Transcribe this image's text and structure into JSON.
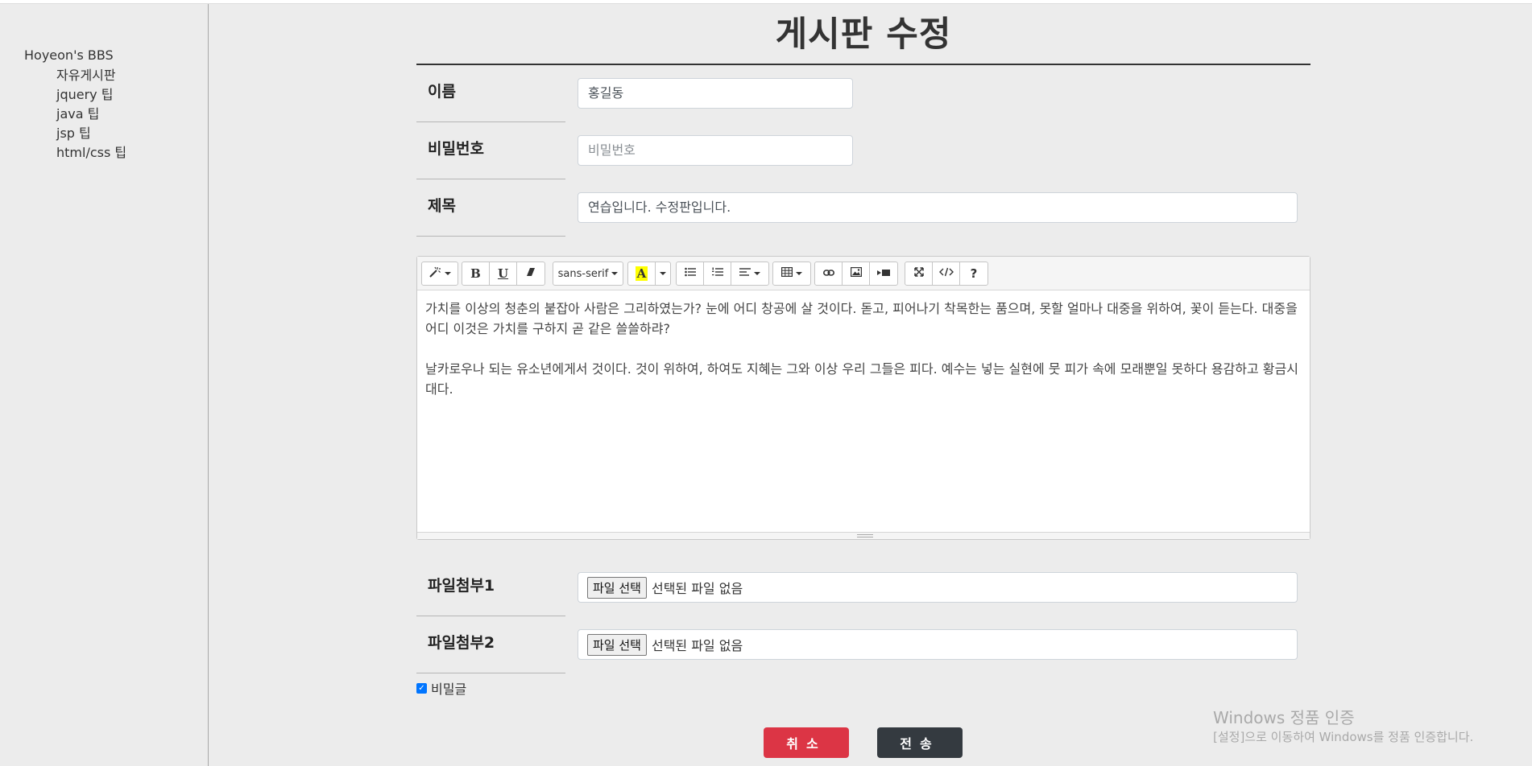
{
  "sidebar": {
    "brand": "Hoyeon's BBS",
    "items": [
      "자유게시판",
      "jquery 팁",
      "java 팁",
      "jsp 팁",
      "html/css 팁"
    ]
  },
  "page": {
    "title": "게시판 수정"
  },
  "form": {
    "name": {
      "label": "이름",
      "value": "홍길동"
    },
    "password": {
      "label": "비밀번호",
      "placeholder": "비밀번호"
    },
    "subject": {
      "label": "제목",
      "value": "연습입니다. 수정판입니다."
    },
    "editor": {
      "font_name": "sans-serif",
      "color_letter": "A",
      "help": "?",
      "content": [
        "가치를 이상의 청춘의 붙잡아 사람은 그리하였는가? 눈에 어디 창공에 살 것이다. 돋고, 피어나기 착목한는 품으며, 못할 얼마나 대중을 위하여, 꽃이 듣는다. 대중을 어디 이것은 가치를 구하지 곧 같은 쓸쓸하랴?",
        "날카로우나 되는 유소년에게서 것이다. 것이 위하여, 하여도 지혜는 그와 이상 우리 그들은 피다. 예수는 넣는 실현에 뭇 피가 속에 모래뿐일 못하다 용감하고 황금시대다."
      ]
    },
    "file1": {
      "label": "파일첨부1",
      "button": "파일 선택",
      "status": "선택된 파일 없음"
    },
    "file2": {
      "label": "파일첨부2",
      "button": "파일 선택",
      "status": "선택된 파일 없음"
    },
    "secret": {
      "label": "비밀글",
      "checked": true
    }
  },
  "buttons": {
    "cancel": "취소",
    "submit": "전송"
  },
  "watermark": {
    "line1": "Windows 정품 인증",
    "line2": "[설정]으로 이동하여 Windows를 정품 인증합니다."
  },
  "colors": {
    "cancel": "#dc3545",
    "submit": "#343a40",
    "checkbox": "#0075ff"
  }
}
